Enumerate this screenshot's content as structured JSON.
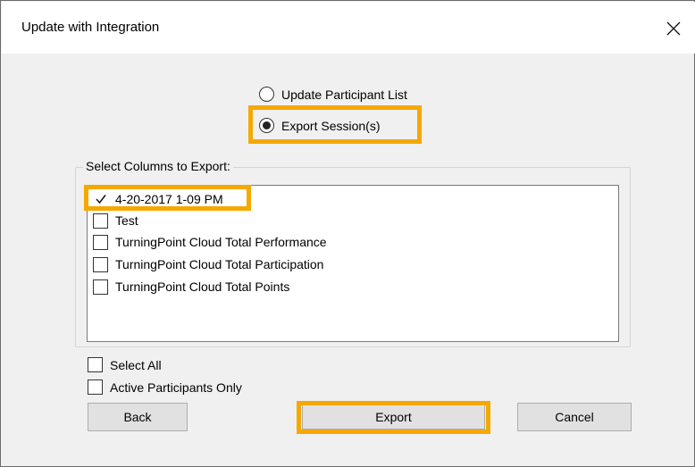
{
  "window": {
    "title": "Update with Integration",
    "close_icon": "close-icon"
  },
  "mode": {
    "options": [
      {
        "label": "Update Participant List",
        "selected": false
      },
      {
        "label": "Export Session(s)",
        "selected": true
      }
    ]
  },
  "columns": {
    "group_label": "Select Columns to Export:",
    "items": [
      {
        "label": "4-20-2017 1-09 PM",
        "checked": true
      },
      {
        "label": "Test",
        "checked": false
      },
      {
        "label": "TurningPoint Cloud Total Performance",
        "checked": false
      },
      {
        "label": "TurningPoint Cloud Total Participation",
        "checked": false
      },
      {
        "label": "TurningPoint Cloud Total Points",
        "checked": false
      }
    ]
  },
  "options": {
    "select_all": {
      "label": "Select All",
      "checked": false
    },
    "active_only": {
      "label": "Active Participants Only",
      "checked": false
    }
  },
  "buttons": {
    "back": "Back",
    "export": "Export",
    "cancel": "Cancel"
  },
  "highlight_color": "#f5a800"
}
